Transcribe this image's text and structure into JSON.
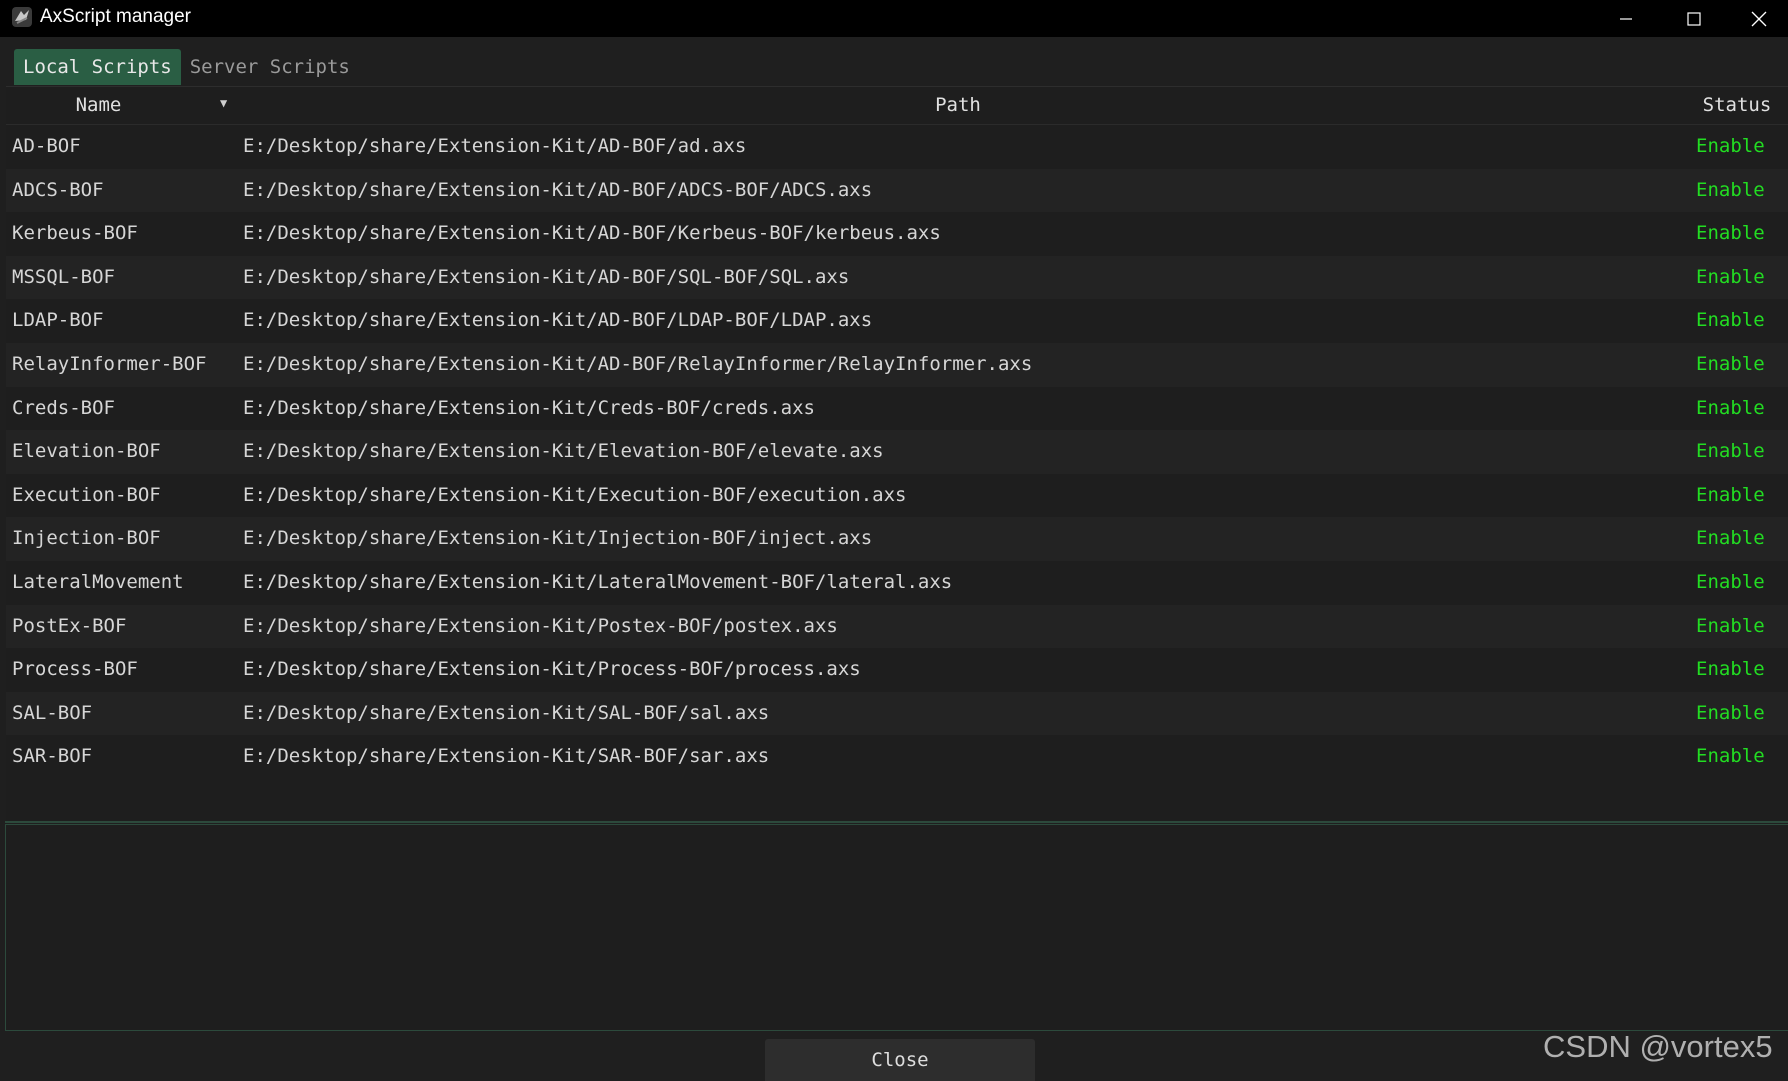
{
  "window": {
    "title": "AxScript manager"
  },
  "tabs": [
    {
      "label": "Local Scripts",
      "active": true
    },
    {
      "label": "Server Scripts",
      "active": false
    }
  ],
  "table": {
    "columns": {
      "name": "Name",
      "path": "Path",
      "status": "Status"
    },
    "sort_indicator": "▼",
    "rows": [
      {
        "name": "AD-BOF",
        "path": "E:/Desktop/share/Extension-Kit/AD-BOF/ad.axs",
        "status": "Enable"
      },
      {
        "name": "ADCS-BOF",
        "path": "E:/Desktop/share/Extension-Kit/AD-BOF/ADCS-BOF/ADCS.axs",
        "status": "Enable"
      },
      {
        "name": "Kerbeus-BOF",
        "path": "E:/Desktop/share/Extension-Kit/AD-BOF/Kerbeus-BOF/kerbeus.axs",
        "status": "Enable"
      },
      {
        "name": "MSSQL-BOF",
        "path": "E:/Desktop/share/Extension-Kit/AD-BOF/SQL-BOF/SQL.axs",
        "status": "Enable"
      },
      {
        "name": "LDAP-BOF",
        "path": "E:/Desktop/share/Extension-Kit/AD-BOF/LDAP-BOF/LDAP.axs",
        "status": "Enable"
      },
      {
        "name": "RelayInformer-BOF",
        "path": "E:/Desktop/share/Extension-Kit/AD-BOF/RelayInformer/RelayInformer.axs",
        "status": "Enable"
      },
      {
        "name": "Creds-BOF",
        "path": "E:/Desktop/share/Extension-Kit/Creds-BOF/creds.axs",
        "status": "Enable"
      },
      {
        "name": "Elevation-BOF",
        "path": "E:/Desktop/share/Extension-Kit/Elevation-BOF/elevate.axs",
        "status": "Enable"
      },
      {
        "name": "Execution-BOF",
        "path": "E:/Desktop/share/Extension-Kit/Execution-BOF/execution.axs",
        "status": "Enable"
      },
      {
        "name": "Injection-BOF",
        "path": "E:/Desktop/share/Extension-Kit/Injection-BOF/inject.axs",
        "status": "Enable"
      },
      {
        "name": "LateralMovement",
        "path": "E:/Desktop/share/Extension-Kit/LateralMovement-BOF/lateral.axs",
        "status": "Enable"
      },
      {
        "name": "PostEx-BOF",
        "path": "E:/Desktop/share/Extension-Kit/Postex-BOF/postex.axs",
        "status": "Enable"
      },
      {
        "name": "Process-BOF",
        "path": "E:/Desktop/share/Extension-Kit/Process-BOF/process.axs",
        "status": "Enable"
      },
      {
        "name": "SAL-BOF",
        "path": "E:/Desktop/share/Extension-Kit/SAL-BOF/sal.axs",
        "status": "Enable"
      },
      {
        "name": "SAR-BOF",
        "path": "E:/Desktop/share/Extension-Kit/SAR-BOF/sar.axs",
        "status": "Enable"
      }
    ]
  },
  "log_panel": {
    "text": ""
  },
  "footer": {
    "close_label": "Close"
  },
  "watermark": "CSDN @vortex5",
  "colors": {
    "status_enable": "#22dd22",
    "active_tab": "#2a5e44",
    "titlebar": "#000000",
    "background": "#1e1e1e"
  },
  "icons": {
    "app": "app-logo-icon",
    "minimize": "minimize-icon",
    "maximize": "maximize-icon",
    "close": "close-icon"
  }
}
